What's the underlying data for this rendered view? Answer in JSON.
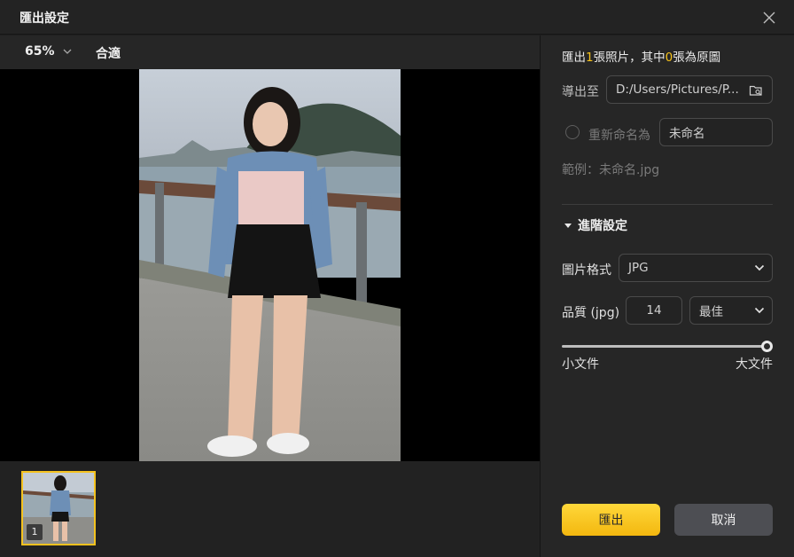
{
  "window": {
    "title": "匯出設定"
  },
  "toolbar": {
    "zoom": "65%",
    "fit_label": "合適"
  },
  "thumbnail": {
    "index": "1"
  },
  "summary": {
    "prefix": "匯出",
    "count_selected": "1",
    "middle": "張照片，其中",
    "count_original": "0",
    "suffix": "張為原圖"
  },
  "export_to": {
    "label": "導出至",
    "path": "D:/Users/Pictures/P..."
  },
  "rename": {
    "label": "重新命名為",
    "value": "未命名",
    "checked": false
  },
  "example": {
    "text": "範例：未命名.jpg"
  },
  "advanced": {
    "label": "進階設定"
  },
  "format": {
    "label": "圖片格式",
    "value": "JPG"
  },
  "quality": {
    "label": "品質 (jpg)",
    "number": "14",
    "preset": "最佳"
  },
  "size_slider": {
    "min_label": "小文件",
    "max_label": "大文件",
    "value": 1.0
  },
  "buttons": {
    "export": "匯出",
    "cancel": "取消"
  },
  "colors": {
    "accent": "#f6c21a",
    "panel": "#262626",
    "background": "#1f1f1f"
  }
}
